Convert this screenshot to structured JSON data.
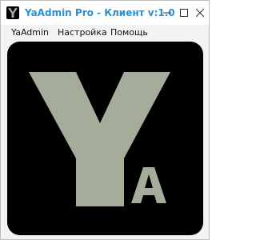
{
  "window": {
    "title": "YaAdmin Pro - Клиент v:1.0",
    "app_icon": "ya-logo-icon",
    "controls": {
      "minimize_icon": "minimize-icon",
      "maximize_icon": "maximize-icon",
      "close_icon": "close-icon"
    }
  },
  "menubar": {
    "items": [
      {
        "label": "YaAdmin"
      },
      {
        "label": "Настройка"
      },
      {
        "label": "Помощь"
      }
    ]
  },
  "logo": {
    "letter_main": "Y",
    "letter_sub": "A",
    "background_color": "#000000",
    "letter_color": "#a3ad99"
  },
  "colors": {
    "title_text": "#2a8fd6",
    "window_bg": "#f3f3f3"
  }
}
